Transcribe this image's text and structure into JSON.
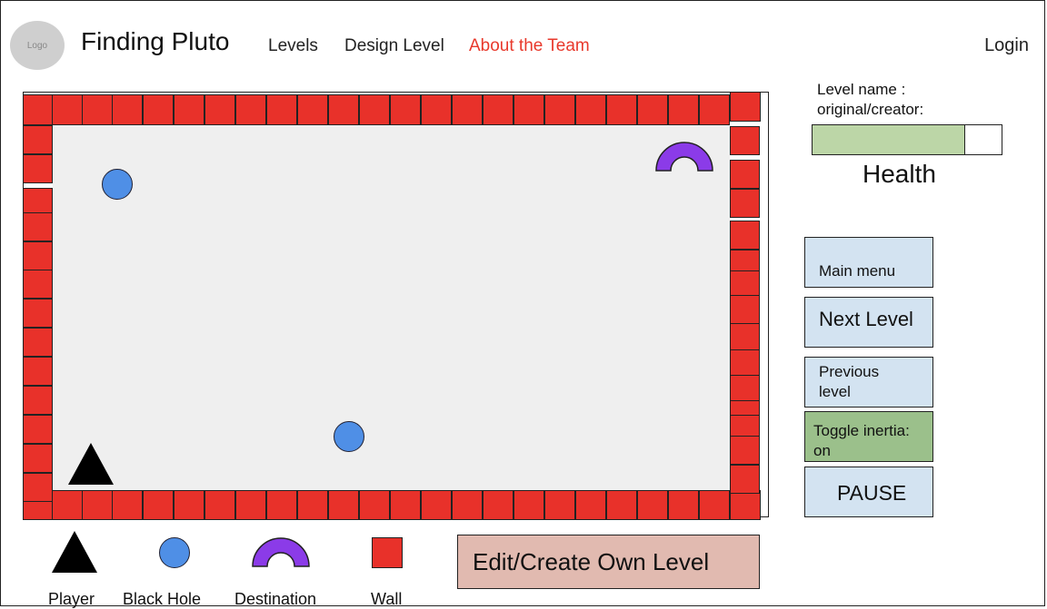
{
  "header": {
    "logo_text": "Logo",
    "title": "Finding Pluto",
    "nav": [
      "Levels",
      "Design Level",
      "About the Team"
    ],
    "login": "Login",
    "accent_color": "#e8392c"
  },
  "game": {
    "wall_color": "#e8312a",
    "black_hole_color": "#4f8fe6",
    "destination_color": "#8b3be8"
  },
  "legend": {
    "player": "Player",
    "black_hole": "Black Hole",
    "destination": "Destination",
    "wall": "Wall"
  },
  "edit_button": "Edit/Create Own Level",
  "info": {
    "level_name": "Level name :",
    "original_creator": "original/creator:",
    "health_label": "Health",
    "health_fraction": 0.81
  },
  "buttons": {
    "main_menu": "Main menu",
    "next_level": "Next Level",
    "previous_line1": "Previous",
    "previous_line2": "level",
    "toggle_line1": "Toggle inertia:",
    "toggle_line2": "on",
    "pause": "PAUSE"
  }
}
